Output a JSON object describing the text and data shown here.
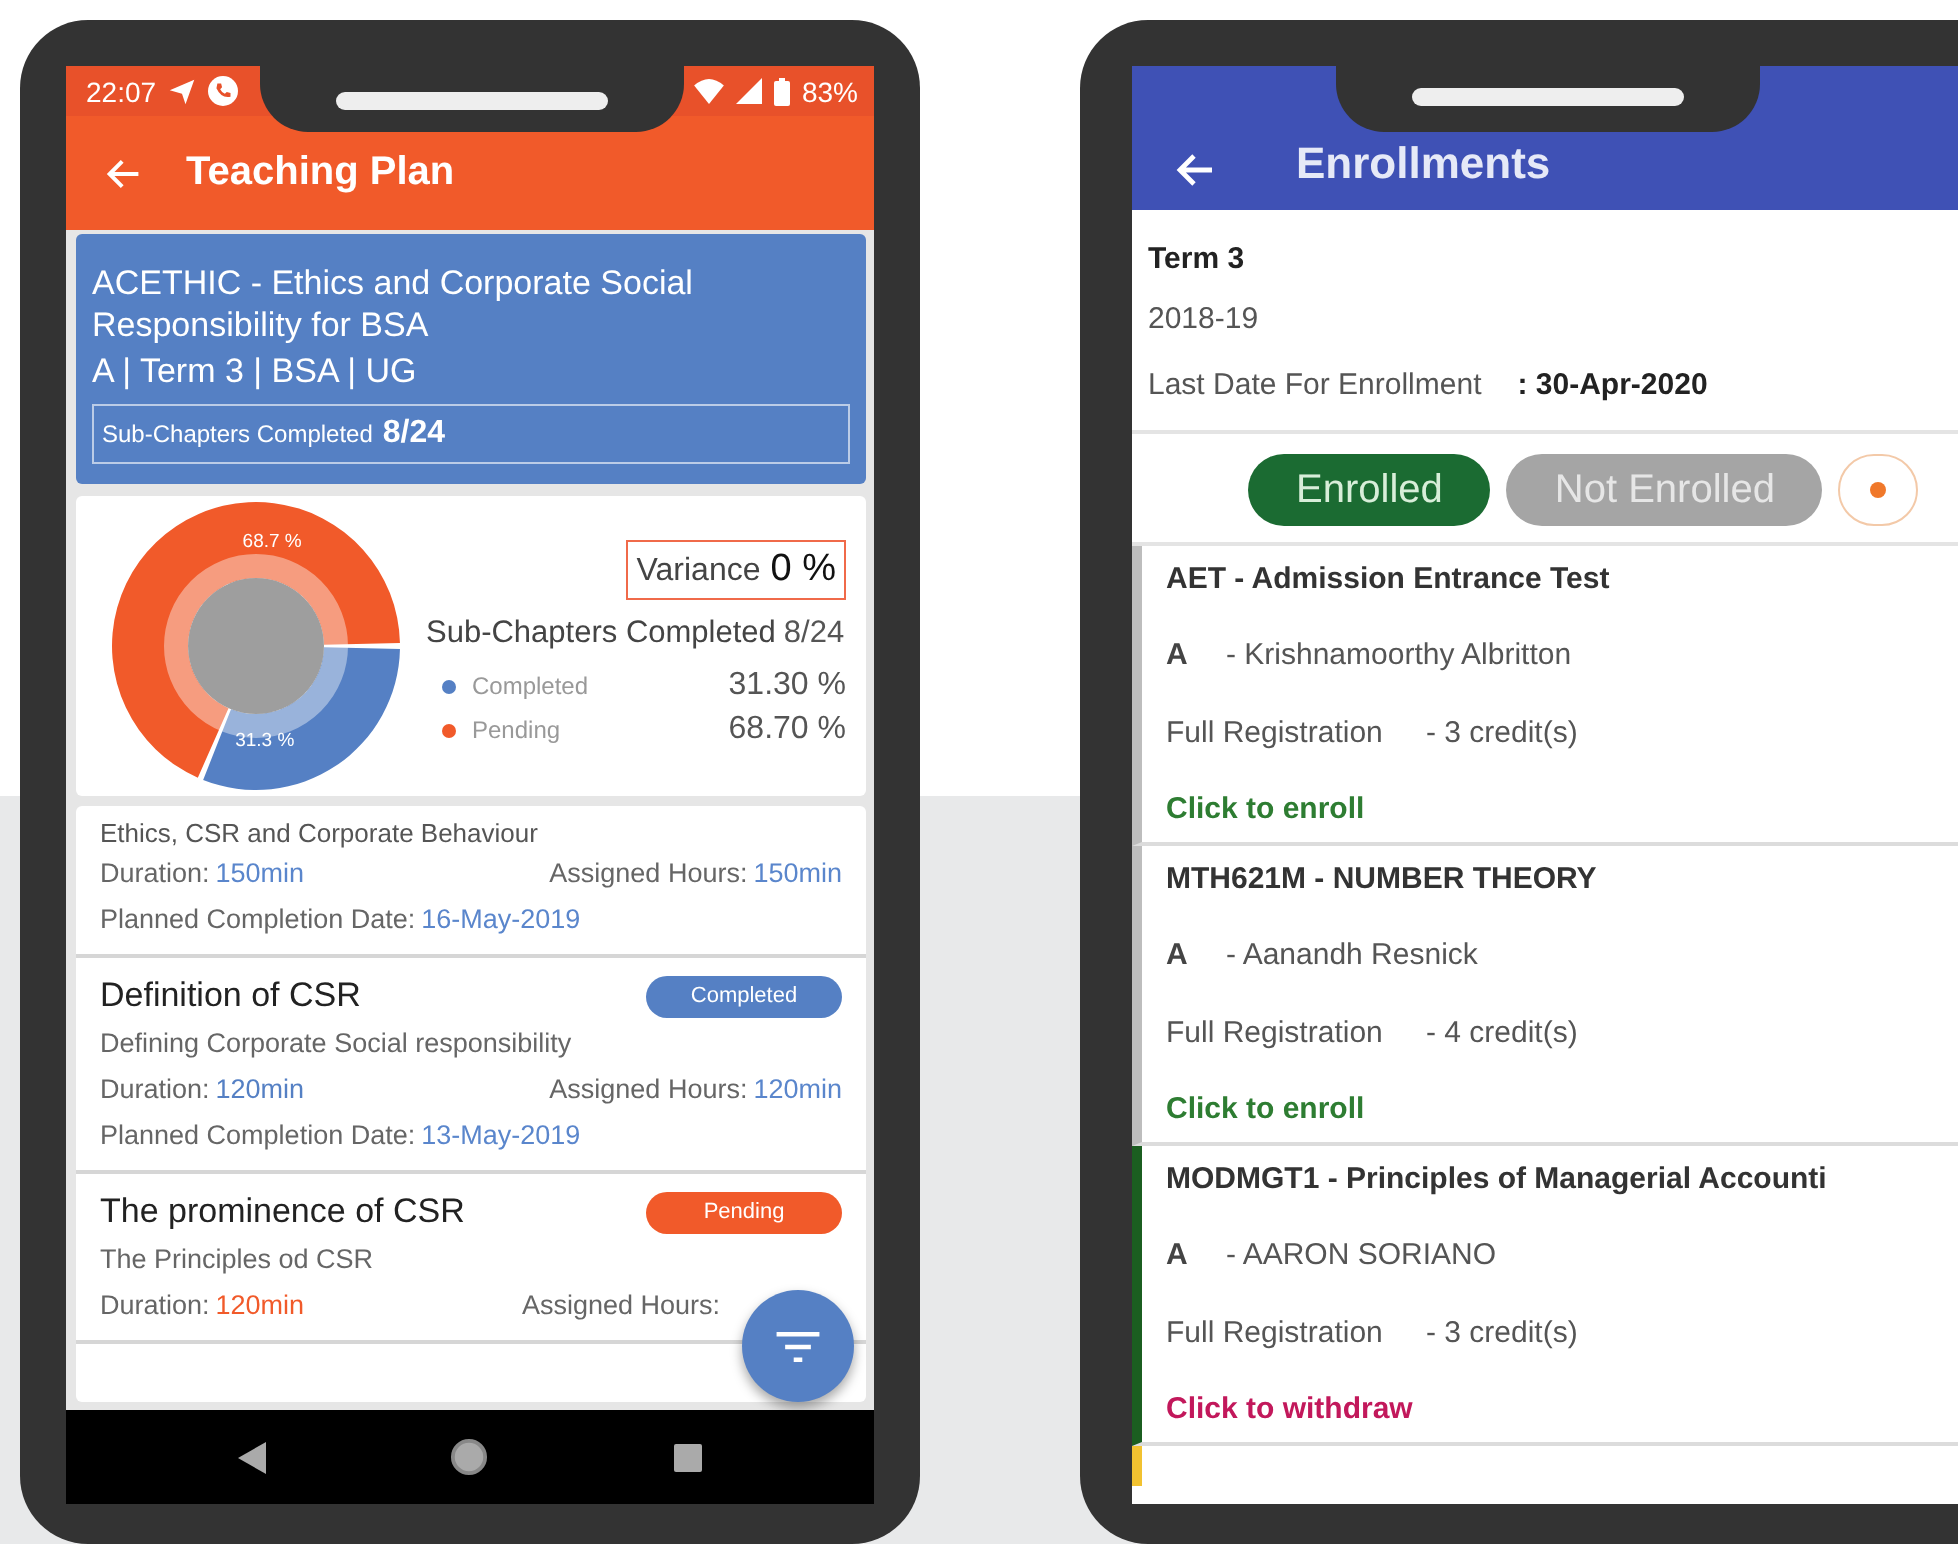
{
  "teaching_plan": {
    "status_bar": {
      "time": "22:07",
      "battery": "83%"
    },
    "title": "Teaching Plan",
    "course": {
      "title": "ACETHIC - Ethics and Corporate Social Responsibility for BSA",
      "meta": "A | Term 3 | BSA | UG",
      "progress_label": "Sub-Chapters Completed",
      "progress_value": "8/24"
    },
    "summary": {
      "variance_label": "Variance",
      "variance_value": "0 %",
      "subtitle_label": "Sub-Chapters Completed",
      "subtitle_value": "8/24",
      "legend": [
        {
          "value": "31.30 %",
          "color": "#5580c4"
        },
        {
          "value": "68.70 %",
          "color": "#f15a2a"
        }
      ],
      "chart_data": {
        "type": "donut",
        "categories": [
          "Completed",
          "Pending"
        ],
        "values": [
          31.3,
          68.7
        ],
        "data_labels": true,
        "value_labels": [
          "31.3 %",
          "68.7 %"
        ]
      }
    },
    "chapters": [
      {
        "title": "Ethics, CSR and Corporate Behaviour",
        "duration_label": "Duration:",
        "duration": "150min",
        "hours_label": "Assigned Hours:",
        "hours": "150min",
        "date_label": "Planned Completion Date:",
        "date": "16-May-2019"
      },
      {
        "title": "Definition of CSR",
        "status": {
          "label": "Completed",
          "kind": "completed"
        },
        "description": "Defining Corporate Social responsibility",
        "duration_label": "Duration:",
        "duration": "120min",
        "hours_label": "Assigned Hours:",
        "hours": "120min",
        "date_label": "Planned Completion Date:",
        "date": "13-May-2019"
      },
      {
        "title": "The prominence of CSR",
        "status": {
          "label": "Pending",
          "kind": "pending"
        },
        "description": "The Principles od CSR",
        "duration_label": "Duration:",
        "duration": "120min",
        "hours_label": "Assigned Hours:"
      }
    ]
  },
  "enrollments": {
    "title": "Enrollments",
    "term": "Term 3",
    "year": "2018-19",
    "deadline_label": "Last Date For Enrollment",
    "deadline_value": ": 30-Apr-2020",
    "filters": [
      {
        "label": "Enrolled",
        "selected": true
      },
      {
        "label": "Not Enrolled",
        "selected": false
      },
      {
        "color": "#f0782a",
        "selected": false
      }
    ],
    "courses": [
      {
        "color": "#bdbdbd",
        "title": "AET - Admission Entrance Test",
        "section": "A",
        "instructor": "- Krishnamoorthy Albritton",
        "registration": "Full Registration",
        "credits": "- 3 credit(s)",
        "action": {
          "label": "Click to enroll",
          "kind": "enroll"
        }
      },
      {
        "color": "#bdbdbd",
        "title": "MTH621M - NUMBER THEORY",
        "section": "A",
        "instructor": "- Aanandh Resnick",
        "registration": "Full Registration",
        "credits": "- 4 credit(s)",
        "action": {
          "label": "Click to enroll",
          "kind": "enroll"
        }
      },
      {
        "color": "#1b5e20",
        "title": "MODMGT1 - Principles of Managerial Accounti",
        "section": "A",
        "instructor": "- AARON SORIANO",
        "registration": "Full Registration",
        "credits": "- 3 credit(s)",
        "action": {
          "label": "Click to withdraw",
          "kind": "withdraw"
        }
      },
      {
        "color": "#f2c230"
      }
    ]
  }
}
